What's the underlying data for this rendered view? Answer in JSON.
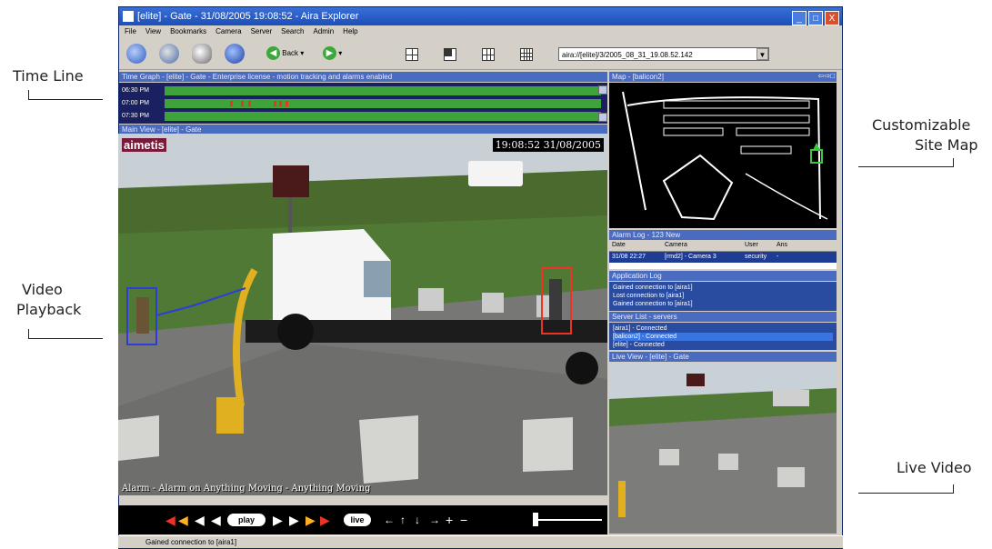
{
  "callouts": {
    "timeline": "Time Line",
    "video_playback_1": "Video",
    "video_playback_2": "Playback",
    "site_map_1": "Customizable",
    "site_map_2": "Site Map",
    "live_video": "Live Video"
  },
  "window": {
    "title": "[elite] - Gate - 31/08/2005 19:08:52 - Aira Explorer",
    "controls": [
      "_",
      "□",
      "X"
    ]
  },
  "menu": [
    "File",
    "View",
    "Bookmarks",
    "Camera",
    "Server",
    "Search",
    "Admin",
    "Help"
  ],
  "toolbar": {
    "back_label": "Back",
    "url": "aira://[elite]/3/2005_08_31_19.08.52.142",
    "icons": [
      "map-icon",
      "camera-icon",
      "search-icon",
      "help-icon"
    ],
    "layouts": [
      "layout-1-icon",
      "layout-2-icon",
      "layout-3-icon",
      "layout-4-icon"
    ]
  },
  "time_graph": {
    "title": "Time Graph - [elite] - Gate - Enterprise license - motion tracking and alarms enabled",
    "rows": [
      "06:30 PM",
      "07:00 PM",
      "07:30 PM"
    ]
  },
  "main_view": {
    "title": "Main View - [elite] - Gate",
    "logo": "aimetis",
    "timestamp": "19:08:52 31/08/2005",
    "alarm_text": "Alarm - Alarm on Anything Moving - Anything Moving"
  },
  "controls": {
    "play_label": "play",
    "live_label": "live"
  },
  "map": {
    "title": "Map - [balicon2]"
  },
  "alarm_log": {
    "title": "Alarm Log - 123 New",
    "headers": [
      "Date",
      "Camera",
      "User",
      "Ans"
    ],
    "row": [
      "31/08 22:27",
      "[rmd2] - Camera 3",
      "security",
      "-"
    ]
  },
  "application_log": {
    "title": "Application Log",
    "lines": [
      "Gained connection to [aira1]",
      "Lost connection to [aira1]",
      "Gained connection to [aira1]"
    ]
  },
  "server_list": {
    "title": "Server List - servers",
    "lines": [
      "[aira1] - Connected",
      "[balicon2] - Connected",
      "[elite] - Connected"
    ]
  },
  "live_view": {
    "title": "Live View - [elite] - Gate"
  },
  "status_bar": {
    "text": "Gained connection to [aira1]"
  },
  "colors": {
    "title_bar": "#1c4fb8",
    "pane_header": "#4a6cc0",
    "timeline_green": "#3ea33a",
    "alarm_red": "#ee3322",
    "tracking_blue": "#2b3fd8"
  }
}
